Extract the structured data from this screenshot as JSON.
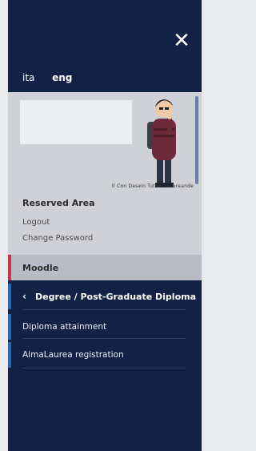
{
  "drawer": {
    "close_icon": "close-icon",
    "languages": [
      {
        "label": "ita",
        "active": false
      },
      {
        "label": "eng",
        "active": true
      }
    ],
    "profile": {
      "avatar_caption": "Il Con Dasein Tuttoì · Laureande"
    },
    "reserved_area": {
      "title": "Reserved Area",
      "links": [
        "Logout",
        "Change Password"
      ]
    },
    "moodle_label": "Moodle",
    "section": {
      "title": "Degree / Post-Graduate Diploma",
      "items": [
        "Diploma attainment",
        "AlmaLaurea registration"
      ]
    }
  },
  "colors": {
    "navy": "#132244",
    "accent_red": "#c0384b",
    "accent_blue": "#2a65b0"
  }
}
